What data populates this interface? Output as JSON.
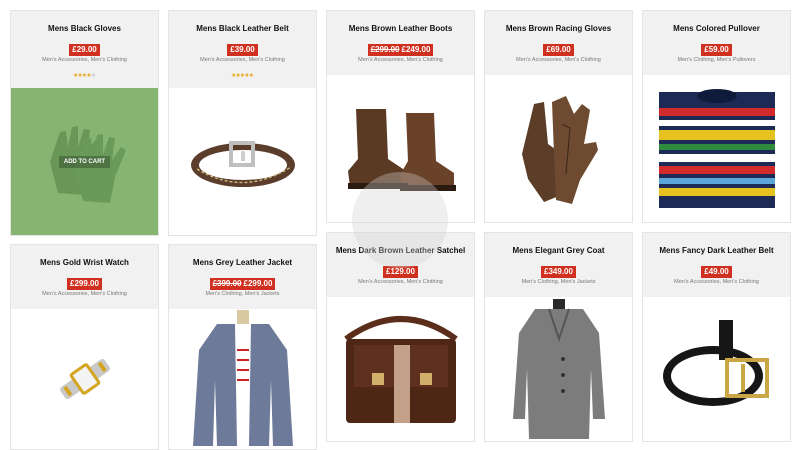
{
  "colors": {
    "price_bg": "#d0301f",
    "card_head_bg": "#f1f1f1",
    "overlay": "#8cbf74"
  },
  "products": [
    {
      "title": "Mens Black Gloves",
      "price": "£29.00",
      "categories": "Men's Accessories, Men's Clothing",
      "rating": 4,
      "add_to_cart": "ADD TO CART",
      "image": "black-gloves"
    },
    {
      "title": "Mens Black Leather Belt",
      "price": "£39.00",
      "categories": "Men's Accessories, Men's Clothing",
      "rating": 5,
      "image": "black-belt"
    },
    {
      "title": "Mens Brown Leather Boots",
      "old_price": "£299.00",
      "price": "£249.00",
      "categories": "Men's Accessories, Men's Clothing",
      "image": "brown-boots"
    },
    {
      "title": "Mens Brown Racing Gloves",
      "price": "£69.00",
      "categories": "Men's Accessories, Men's Clothing",
      "image": "brown-gloves"
    },
    {
      "title": "Mens Colored Pullover",
      "price": "£59.00",
      "categories": "Men's Clothing, Men's Pullovers",
      "image": "colored-pullover"
    },
    {
      "title": "Mens Gold Wrist Watch",
      "price": "£299.00",
      "categories": "Men's Accessories, Men's Clothing",
      "image": "gold-watch"
    },
    {
      "title": "Mens Grey Leather Jacket",
      "old_price": "£399.00",
      "price": "£299.00",
      "categories": "Men's Clothing, Men's Jackets",
      "image": "grey-jacket"
    },
    {
      "title": "Mens Dark Brown Leather Satchel",
      "price": "£129.00",
      "categories": "Men's Accessories, Men's Clothing",
      "image": "leather-satchel"
    },
    {
      "title": "Mens Elegant Grey Coat",
      "price": "£349.00",
      "categories": "Men's Clothing, Men's Jackets",
      "image": "grey-coat"
    },
    {
      "title": "Mens Fancy Dark Leather Belt",
      "price": "£49.00",
      "categories": "Men's Accessories, Men's Clothing",
      "image": "dark-belt"
    }
  ]
}
